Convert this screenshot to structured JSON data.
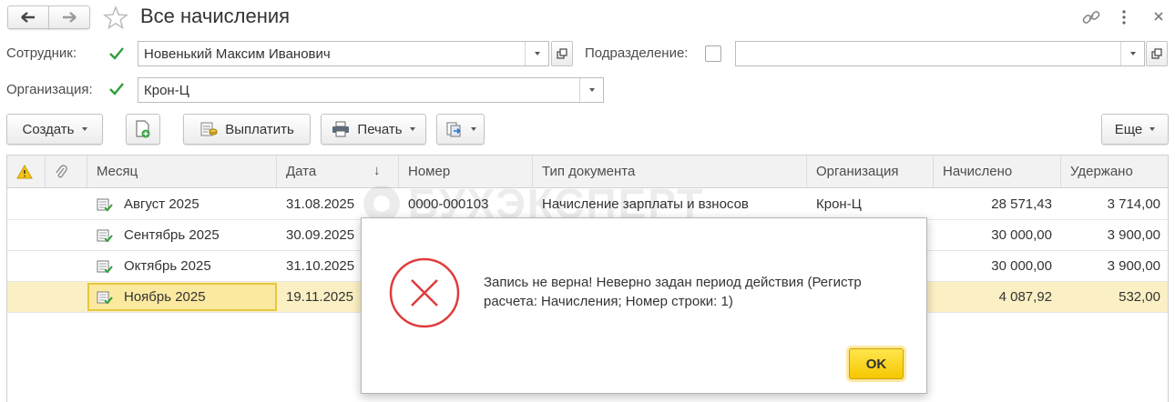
{
  "window": {
    "title": "Все начисления",
    "back_icon": "arrow-left-icon",
    "forward_icon": "arrow-right-icon",
    "favorite_icon": "star-icon",
    "link_icon": "link-icon",
    "more_icon": "vertical-dots-icon",
    "close_icon": "close-icon"
  },
  "filters": {
    "employee_label": "Сотрудник:",
    "employee_checked": true,
    "employee_value": "Новенький Максим Иванович",
    "department_label": "Подразделение:",
    "department_checked": false,
    "department_value": "",
    "organization_label": "Организация:",
    "organization_checked": true,
    "organization_value": "Крон-Ц"
  },
  "toolbar": {
    "create_label": "Создать",
    "pay_label": "Выплатить",
    "print_label": "Печать",
    "more_label": "Еще"
  },
  "table": {
    "columns": {
      "warning": "",
      "attachment": "",
      "month": "Месяц",
      "date": "Дата",
      "sort_arrow": "↓",
      "number": "Номер",
      "doc_type": "Тип документа",
      "organization": "Организация",
      "accrued": "Начислено",
      "withheld": "Удержано"
    },
    "rows": [
      {
        "month": "Август 2025",
        "date": "31.08.2025",
        "number": "0000-000103",
        "doc_type": "Начисление зарплаты и взносов",
        "organization": "Крон-Ц",
        "accrued": "28 571,43",
        "withheld": "3 714,00"
      },
      {
        "month": "Сентябрь 2025",
        "date": "30.09.2025",
        "number": "",
        "doc_type": "",
        "organization": "",
        "accrued": "30 000,00",
        "withheld": "3 900,00"
      },
      {
        "month": "Октябрь 2025",
        "date": "31.10.2025",
        "number": "",
        "doc_type": "",
        "organization": "",
        "accrued": "30 000,00",
        "withheld": "3 900,00"
      },
      {
        "month": "Ноябрь 2025",
        "date": "19.11.2025",
        "number": "",
        "doc_type": "",
        "organization": "",
        "accrued": "4 087,92",
        "withheld": "532,00"
      }
    ],
    "selected_row": 3
  },
  "dialog": {
    "icon": "error-cross-icon",
    "message": "Запись не верна! Неверно задан период действия (Регистр расчета: Начисления; Номер строки: 1)",
    "ok_label": "OK"
  },
  "watermark": "БУХЭКСПЕРТ",
  "colors": {
    "accent_check": "#2e9e3a",
    "selected_row": "#fbf0c4",
    "error_red": "#e03b3b",
    "ok_button": "#f6c700"
  }
}
